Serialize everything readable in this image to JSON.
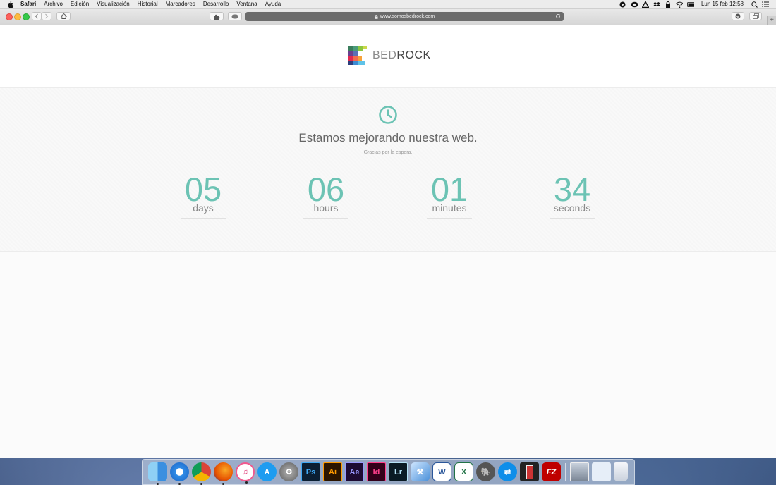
{
  "menubar": {
    "app_name": "Safari",
    "items": [
      "Archivo",
      "Edición",
      "Visualización",
      "Historial",
      "Marcadores",
      "Desarrollo",
      "Ventana",
      "Ayuda"
    ],
    "clock": "Lun 15 feb  12:58"
  },
  "browser": {
    "url": "www.somosbedrock.com",
    "new_tab_label": "+"
  },
  "site": {
    "logo_prefix": "BED",
    "logo_suffix": "ROCK",
    "headline": "Estamos mejorando nuestra web.",
    "subline": "Gracias por la espera.",
    "accent_color": "#6cc3b4",
    "countdown": [
      {
        "value": "05",
        "unit": "days"
      },
      {
        "value": "06",
        "unit": "hours"
      },
      {
        "value": "01",
        "unit": "minutes"
      },
      {
        "value": "34",
        "unit": "seconds"
      }
    ]
  },
  "dock": {
    "apps": [
      {
        "name": "finder",
        "label": ""
      },
      {
        "name": "safari",
        "label": ""
      },
      {
        "name": "chrome",
        "label": ""
      },
      {
        "name": "firefox",
        "label": ""
      },
      {
        "name": "itunes",
        "label": ""
      },
      {
        "name": "app-store",
        "label": ""
      },
      {
        "name": "system-preferences",
        "label": ""
      },
      {
        "name": "photoshop",
        "label": "Ps"
      },
      {
        "name": "illustrator",
        "label": "Ai"
      },
      {
        "name": "after-effects",
        "label": "Ae"
      },
      {
        "name": "indesign",
        "label": "Id"
      },
      {
        "name": "lightroom",
        "label": "Lr"
      },
      {
        "name": "xcode",
        "label": ""
      },
      {
        "name": "word",
        "label": "W"
      },
      {
        "name": "excel",
        "label": "X"
      },
      {
        "name": "mamp",
        "label": ""
      },
      {
        "name": "teamviewer",
        "label": ""
      },
      {
        "name": "battery-app",
        "label": ""
      },
      {
        "name": "filezilla",
        "label": "FZ"
      },
      {
        "name": "preview-photo",
        "label": ""
      },
      {
        "name": "downloads-folder",
        "label": ""
      },
      {
        "name": "trash",
        "label": ""
      }
    ]
  }
}
